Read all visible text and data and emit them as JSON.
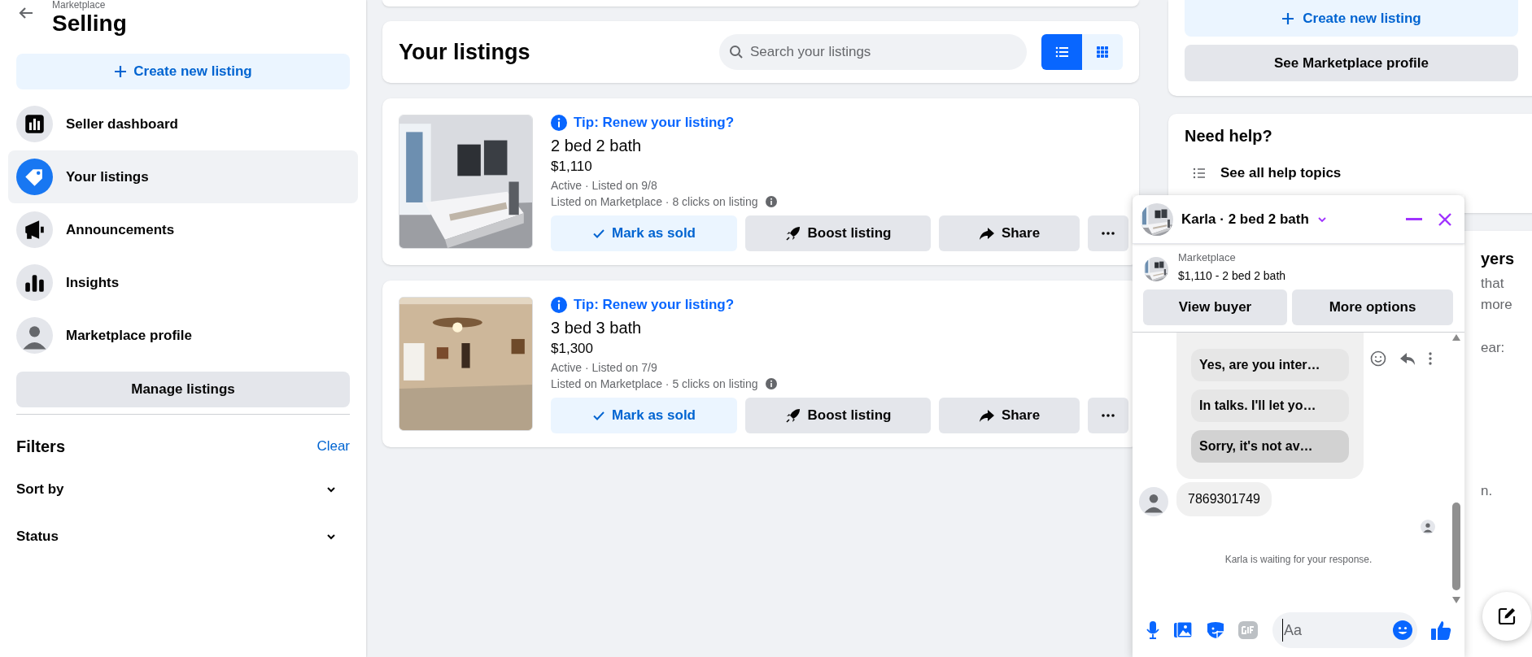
{
  "sidebar": {
    "subtitle": "Marketplace",
    "title": "Selling",
    "create_button": "Create new listing",
    "items": [
      {
        "label": "Seller dashboard",
        "kind": "dashboard",
        "selected": false
      },
      {
        "label": "Your listings",
        "kind": "tag",
        "selected": true
      },
      {
        "label": "Announcements",
        "kind": "megaphone",
        "selected": false
      },
      {
        "label": "Insights",
        "kind": "insights",
        "selected": false
      },
      {
        "label": "Marketplace profile",
        "kind": "profile",
        "selected": false
      }
    ],
    "manage_button": "Manage listings",
    "filters": {
      "title": "Filters",
      "clear": "Clear",
      "dropdowns": [
        {
          "label": "Sort by"
        },
        {
          "label": "Status"
        }
      ]
    }
  },
  "listings_header": {
    "title": "Your listings",
    "search": {
      "placeholder": "Search your listings"
    },
    "view_toggle": [
      {
        "kind": "list",
        "selected": true
      },
      {
        "kind": "grid",
        "selected": false
      }
    ]
  },
  "listings": [
    {
      "tip": "Tip: Renew your listing?",
      "title": "2 bed 2 bath",
      "price": "$1,110",
      "status_line": "Active · Listed on 9/8",
      "stats_line": "Listed on Marketplace · 8 clicks on listing",
      "actions": [
        "Mark as sold",
        "Boost listing",
        "Share"
      ]
    },
    {
      "tip": "Tip: Renew your listing?",
      "title": "3 bed 3 bath",
      "price": "$1,300",
      "status_line": "Active · Listed on 7/9",
      "stats_line": "Listed on Marketplace · 5 clicks on listing",
      "actions": [
        "Mark as sold",
        "Boost listing",
        "Share"
      ]
    }
  ],
  "right_column": {
    "create_button": "Create new listing",
    "profile_button": "See Marketplace profile",
    "help": {
      "title": "Need help?",
      "link": "See all help topics"
    },
    "partial_card": [
      "yers",
      "that",
      "more",
      "ear:",
      "n."
    ]
  },
  "chat": {
    "title": "Karla · 2 bed 2 bath",
    "context_label": "Marketplace",
    "context_detail": "$1,110 - 2 bed 2 bath",
    "buttons": [
      "View buyer",
      "More options"
    ],
    "quick_replies": [
      {
        "label": "Yes, are you inter…",
        "hovered": false
      },
      {
        "label": "In talks. I'll let yo…",
        "hovered": false
      },
      {
        "label": "Sorry, it's not av…",
        "hovered": true
      }
    ],
    "messages": [
      {
        "text": "7869301749"
      }
    ],
    "status_note": "Karla is waiting for your response.",
    "composer": {
      "placeholder": "Aa"
    }
  }
}
